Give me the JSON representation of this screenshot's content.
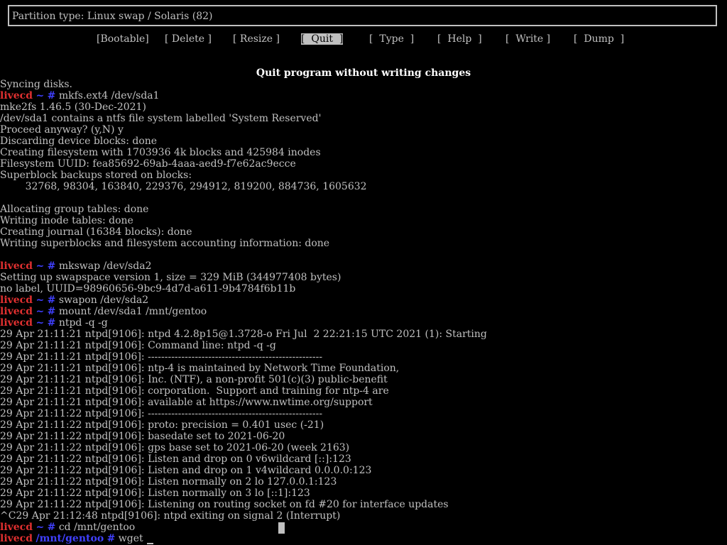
{
  "partition_type": "Partition type: Linux swap / Solaris (82)",
  "menu": [
    {
      "label": "[Bootable]"
    },
    {
      "label": "[ Delete ]"
    },
    {
      "label": "[ Resize ]"
    },
    {
      "label": "[  Quit  ]",
      "selected": true
    },
    {
      "label": "[  Type  ]"
    },
    {
      "label": "[  Help  ]"
    },
    {
      "label": "[  Write ]"
    },
    {
      "label": "[  Dump  ]"
    }
  ],
  "hint": "Quit program without writing changes",
  "prompt": {
    "host": "livecd",
    "home_dir": "~",
    "gentoo_dir": "/mnt/gentoo",
    "symbol": "#"
  },
  "lines": [
    {
      "text": "Syncing disks."
    },
    {
      "dir": "~",
      "cmd": "mkfs.ext4 /dev/sda1"
    },
    {
      "text": "mke2fs 1.46.5 (30-Dec-2021)"
    },
    {
      "text": "/dev/sda1 contains a ntfs file system labelled 'System Reserved'"
    },
    {
      "text": "Proceed anyway? (y,N) y"
    },
    {
      "text": "Discarding device blocks: done"
    },
    {
      "text": "Creating filesystem with 1703936 4k blocks and 425984 inodes"
    },
    {
      "text": "Filesystem UUID: fea85692-69ab-4aaa-aed9-f7e62ac9ecce"
    },
    {
      "text": "Superblock backups stored on blocks:"
    },
    {
      "text": "        32768, 98304, 163840, 229376, 294912, 819200, 884736, 1605632"
    },
    {
      "text": ""
    },
    {
      "text": "Allocating group tables: done"
    },
    {
      "text": "Writing inode tables: done"
    },
    {
      "text": "Creating journal (16384 blocks): done"
    },
    {
      "text": "Writing superblocks and filesystem accounting information: done"
    },
    {
      "text": ""
    },
    {
      "dir": "~",
      "cmd": "mkswap /dev/sda2"
    },
    {
      "text": "Setting up swapspace version 1, size = 329 MiB (344977408 bytes)"
    },
    {
      "text": "no label, UUID=98960656-9bc9-4d7d-a611-9b4784f6b11b"
    },
    {
      "dir": "~",
      "cmd": "swapon /dev/sda2"
    },
    {
      "dir": "~",
      "cmd": "mount /dev/sda1 /mnt/gentoo"
    },
    {
      "dir": "~",
      "cmd": "ntpd -q -g"
    },
    {
      "text": "29 Apr 21:11:21 ntpd[9106]: ntpd 4.2.8p15@1.3728-o Fri Jul  2 22:21:15 UTC 2021 (1): Starting"
    },
    {
      "text": "29 Apr 21:11:21 ntpd[9106]: Command line: ntpd -q -g"
    },
    {
      "text": "29 Apr 21:11:21 ntpd[9106]: ----------------------------------------------------"
    },
    {
      "text": "29 Apr 21:11:21 ntpd[9106]: ntp-4 is maintained by Network Time Foundation,"
    },
    {
      "text": "29 Apr 21:11:21 ntpd[9106]: Inc. (NTF), a non-profit 501(c)(3) public-benefit"
    },
    {
      "text": "29 Apr 21:11:21 ntpd[9106]: corporation.  Support and training for ntp-4 are"
    },
    {
      "text": "29 Apr 21:11:21 ntpd[9106]: available at https://www.nwtime.org/support"
    },
    {
      "text": "29 Apr 21:11:22 ntpd[9106]: ----------------------------------------------------"
    },
    {
      "text": "29 Apr 21:11:22 ntpd[9106]: proto: precision = 0.401 usec (-21)"
    },
    {
      "text": "29 Apr 21:11:22 ntpd[9106]: basedate set to 2021-06-20"
    },
    {
      "text": "29 Apr 21:11:22 ntpd[9106]: gps base set to 2021-06-20 (week 2163)"
    },
    {
      "text": "29 Apr 21:11:22 ntpd[9106]: Listen and drop on 0 v6wildcard [::]:123"
    },
    {
      "text": "29 Apr 21:11:22 ntpd[9106]: Listen and drop on 1 v4wildcard 0.0.0.0:123"
    },
    {
      "text": "29 Apr 21:11:22 ntpd[9106]: Listen normally on 2 lo 127.0.0.1:123"
    },
    {
      "text": "29 Apr 21:11:22 ntpd[9106]: Listen normally on 3 lo [::1]:123"
    },
    {
      "text": "29 Apr 21:11:22 ntpd[9106]: Listening on routing socket on fd #20 for interface updates"
    },
    {
      "text": "^C29 Apr 21:12:48 ntpd[9106]: ntpd exiting on signal 2 (Interrupt)"
    },
    {
      "dir": "~",
      "cmd": "cd /mnt/gentoo"
    },
    {
      "dir": "/mnt/gentoo",
      "cmd": "wget"
    }
  ],
  "colors": {
    "background": "#000000",
    "foreground": "#c0c0c0",
    "host": "#e03030",
    "path": "#4040ff"
  }
}
